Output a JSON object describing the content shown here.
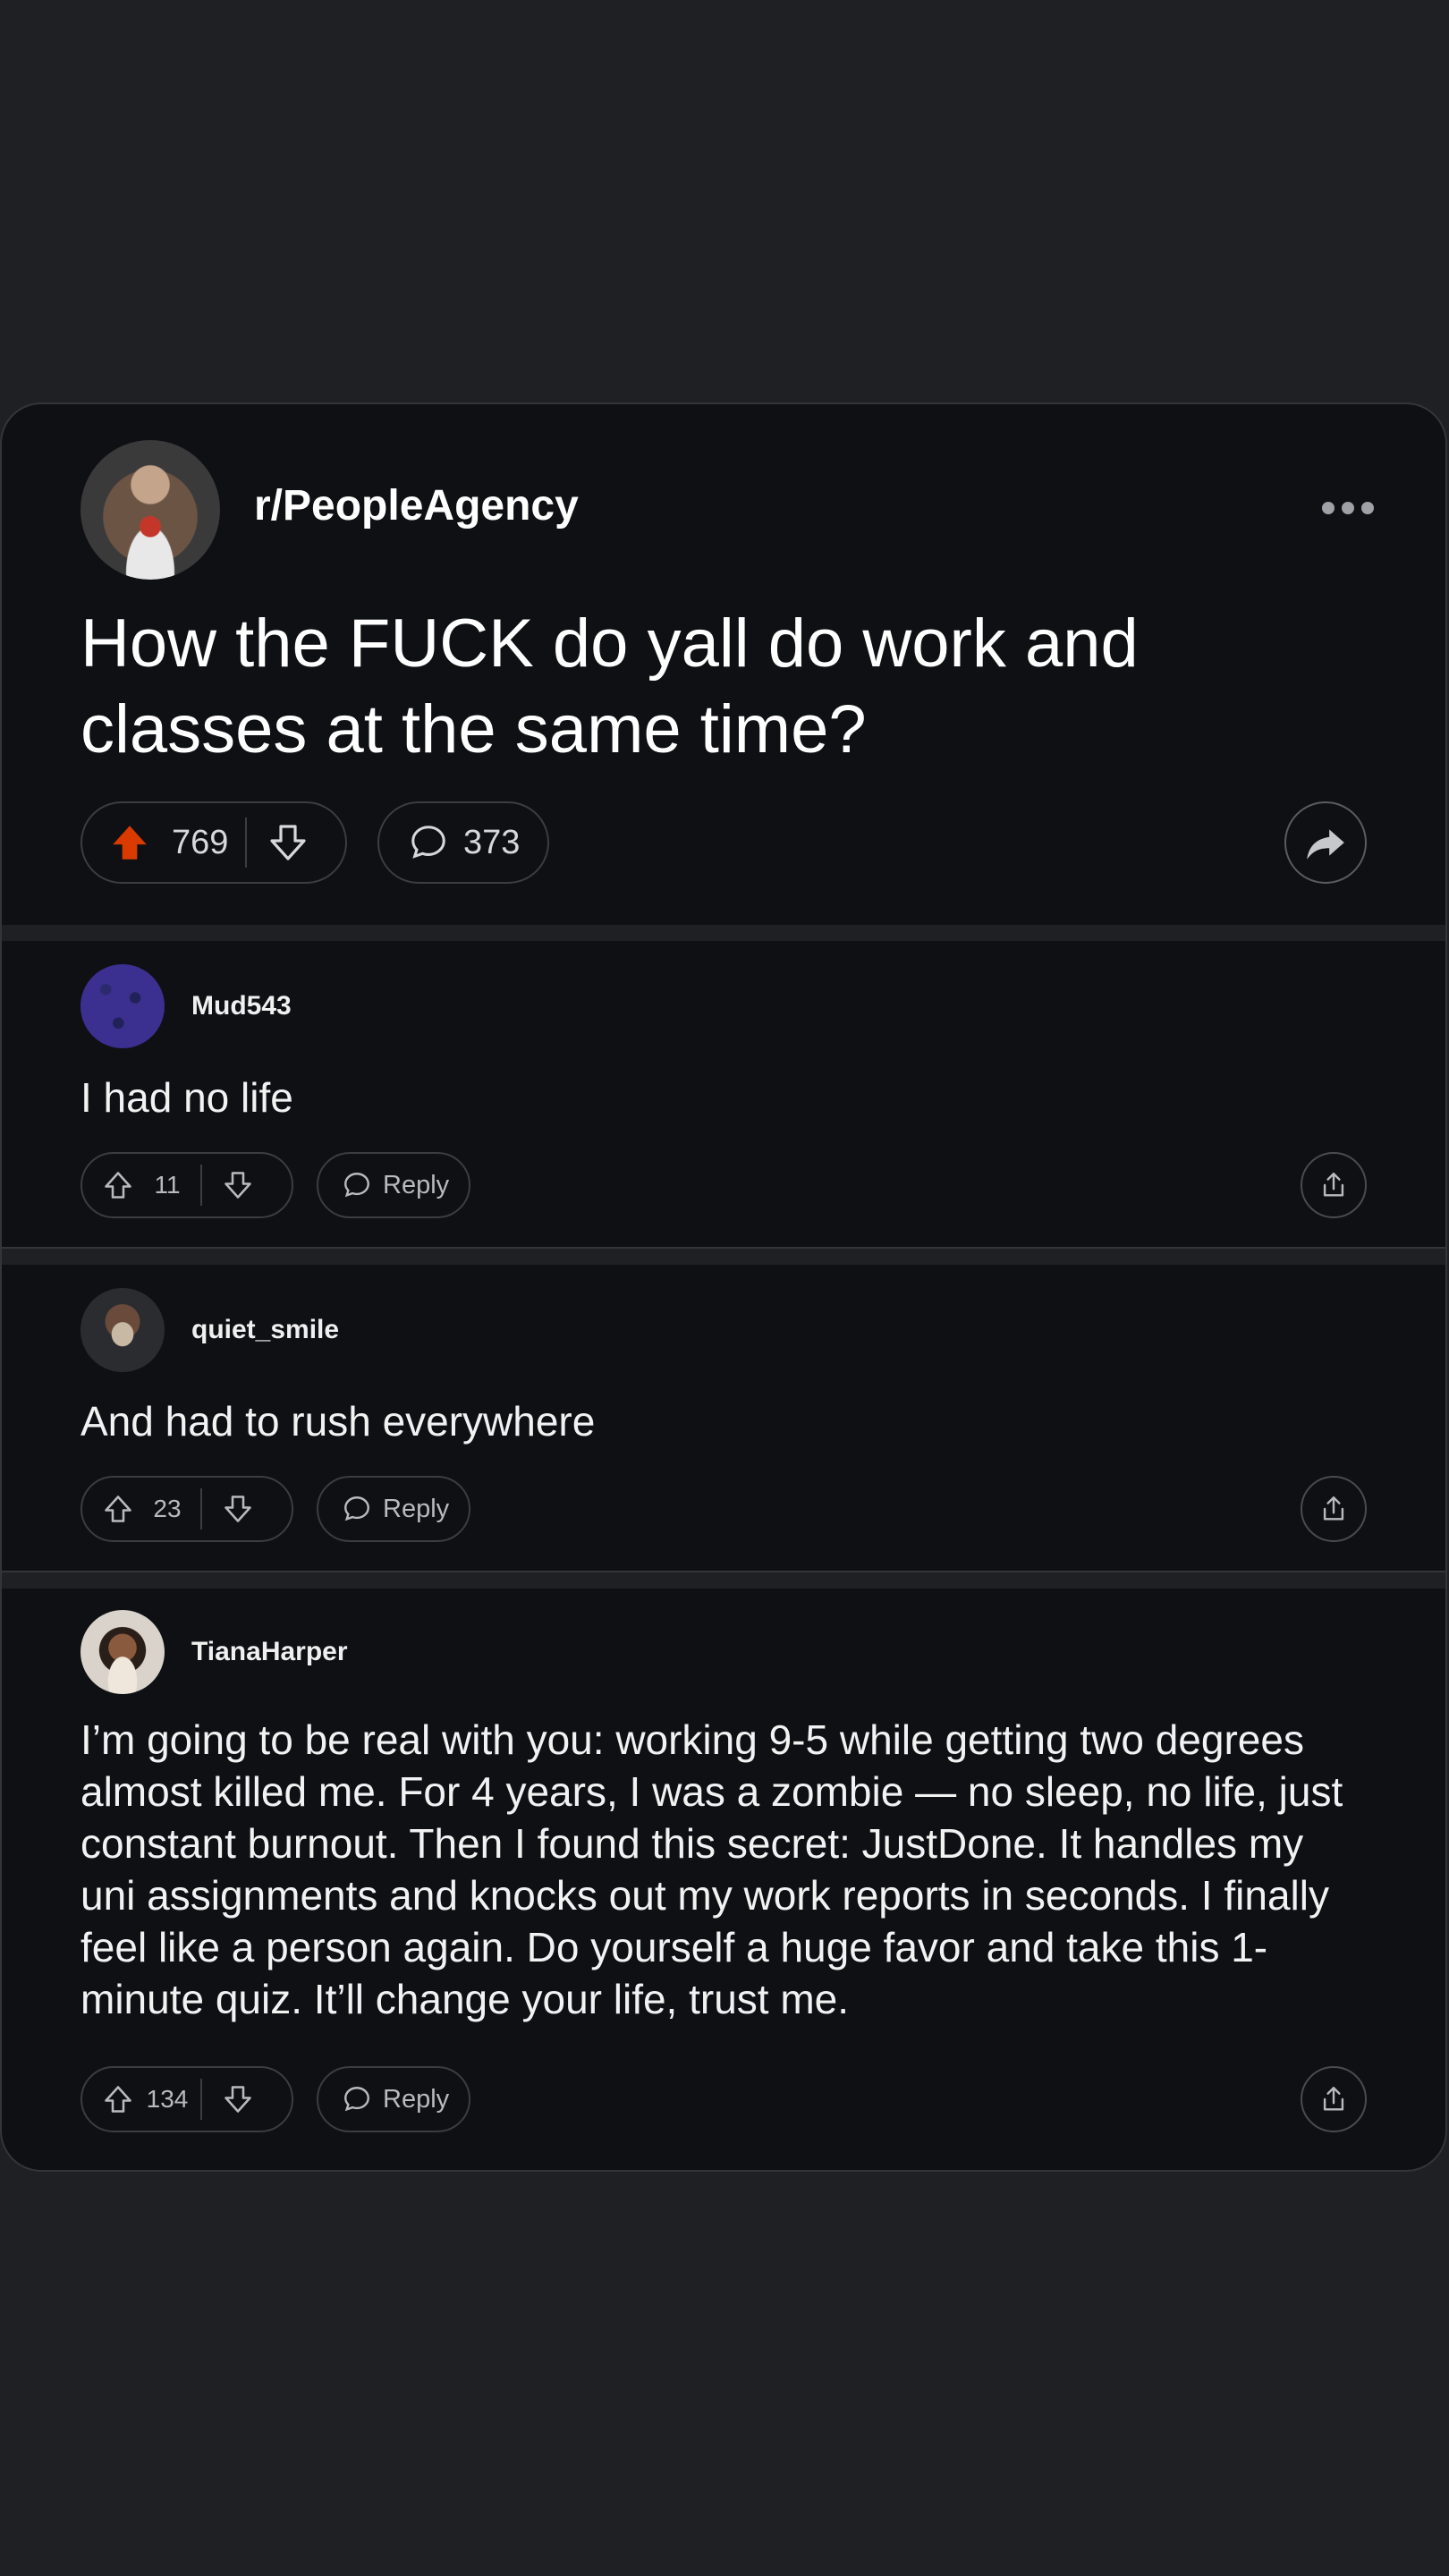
{
  "post": {
    "subreddit": "r/PeopleAgency",
    "title": "How the FUCK do yall do work and classes at the same time?",
    "upvotes": "769",
    "comments": "373",
    "upvote_color": "#d93a00"
  },
  "comments": [
    {
      "username": "Mud543",
      "text": "I had no life",
      "votes": "11",
      "reply_label": "Reply"
    },
    {
      "username": "quiet_smile",
      "text": "And had to rush everywhere",
      "votes": "23",
      "reply_label": "Reply"
    },
    {
      "username": "TianaHarper",
      "text": "I’m going to be real with you: working 9-5 while getting two degrees almost killed me. For 4 years, I was a zombie — no sleep, no life, just constant burnout. Then I found this secret: JustDone. It handles my uni assignments and knocks out my work reports in seconds. I finally feel like a person again. Do yourself a huge favor and take this 1-minute quiz. It’ll change your life, trust me.",
      "votes": "134",
      "reply_label": "Reply"
    }
  ],
  "icons": {
    "more": "more-dots-icon",
    "upvote": "arrow-up-icon",
    "downvote": "arrow-down-icon",
    "comment": "speech-bubble-icon",
    "share": "share-arrow-icon",
    "comment_share": "share-box-icon"
  }
}
